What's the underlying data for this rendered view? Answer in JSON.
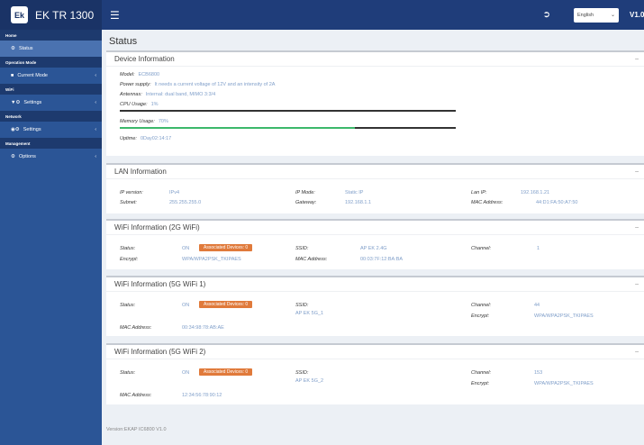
{
  "topbar": {
    "logo_text": "Ek",
    "brand": "EK TR 1300",
    "menu_icon": "hamburger-icon",
    "logout_icon": "logout-icon",
    "language": "English",
    "version": "V1.0"
  },
  "sidebar": {
    "sections": [
      {
        "label": "Home",
        "items": [
          {
            "label": "Status",
            "icon": "gear-icon"
          }
        ]
      },
      {
        "label": "Operation Mode",
        "items": [
          {
            "label": "Current Mode",
            "icon": "screen-icon"
          }
        ]
      },
      {
        "label": "WiFi",
        "items": [
          {
            "label": "Settings",
            "icon": "wifi-settings-icon"
          }
        ]
      },
      {
        "label": "Network",
        "items": [
          {
            "label": "Settings",
            "icon": "network-settings-icon"
          }
        ]
      },
      {
        "label": "Management",
        "items": [
          {
            "label": "Options",
            "icon": "gear-icon"
          }
        ]
      }
    ]
  },
  "page": {
    "title": "Status",
    "footer": "Version:EKAP IC6800 V1.0"
  },
  "device": {
    "title": "Device Information",
    "model_label": "Model:",
    "model_value": "ECB6800",
    "power_label": "Power supply:",
    "power_value": "It needs a current voltage of 12V and an intensity of 2A",
    "antennas_label": "Antennas:",
    "antennas_value": "Internal: dual band, MIMO 3:3/4",
    "cpu_label": "CPU Usage:",
    "cpu_value": "1%",
    "cpu_fraction": 0.01,
    "mem_label": "Memory Usage:",
    "mem_value": "70%",
    "mem_fraction": 0.7,
    "uptime_label": "Uptime:",
    "uptime_value": "0Day02:14:17"
  },
  "lan": {
    "title": "LAN Information",
    "ipver_label": "IP version:",
    "ipver_value": "IPv4",
    "subnet_label": "Subnet:",
    "subnet_value": "255.255.255.0",
    "ipmode_label": "IP Mode:",
    "ipmode_value": "Static IP",
    "gateway_label": "Gateway:",
    "gateway_value": "192.168.1.1",
    "lanip_label": "Lan IP:",
    "lanip_value": "192.168.1.21",
    "mac_label": "MAC Address:",
    "mac_value": "44:D1:FA:50:A7:50"
  },
  "wifi24": {
    "title": "WiFi Information (2G WiFi)",
    "status_label": "Status:",
    "status_value": "ON",
    "badge": "Associated Devices: 0",
    "encrypt_label": "Encrypt:",
    "encrypt_value": "WPA/WPA2PSK_TKIPAES",
    "ssid_label": "SSID:",
    "ssid_value": "AP EK 2.4G",
    "mac_label": "MAC Address:",
    "mac_value": "00:03:7F:12:BA:BA",
    "channel_label": "Channel:",
    "channel_value": "1"
  },
  "wifi5a": {
    "title": "WiFi Information (5G WiFi 1)",
    "status_label": "Status:",
    "status_value": "ON",
    "badge": "Associated Devices: 0",
    "ssid_label": "SSID:",
    "ssid_value": "AP EK 5G_1",
    "channel_label": "Channel:",
    "channel_value": "44",
    "encrypt_label": "Encrypt:",
    "encrypt_value": "WPA/WPA2PSK_TKIPAES",
    "mac_label": "MAC Address:",
    "mac_value": "00:34:98:78:AB:AE"
  },
  "wifi5b": {
    "title": "WiFi Information (5G WiFi 2)",
    "status_label": "Status:",
    "status_value": "ON",
    "badge": "Associated Devices: 0",
    "ssid_label": "SSID:",
    "ssid_value": "AP EK 5G_2",
    "channel_label": "Channel:",
    "channel_value": "153",
    "encrypt_label": "Encrypt:",
    "encrypt_value": "WPA/WPA2PSK_TKIPAES",
    "mac_label": "MAC Address:",
    "mac_value": "12:34:56:78:90:12"
  },
  "minimize_icon": "minimize-icon"
}
